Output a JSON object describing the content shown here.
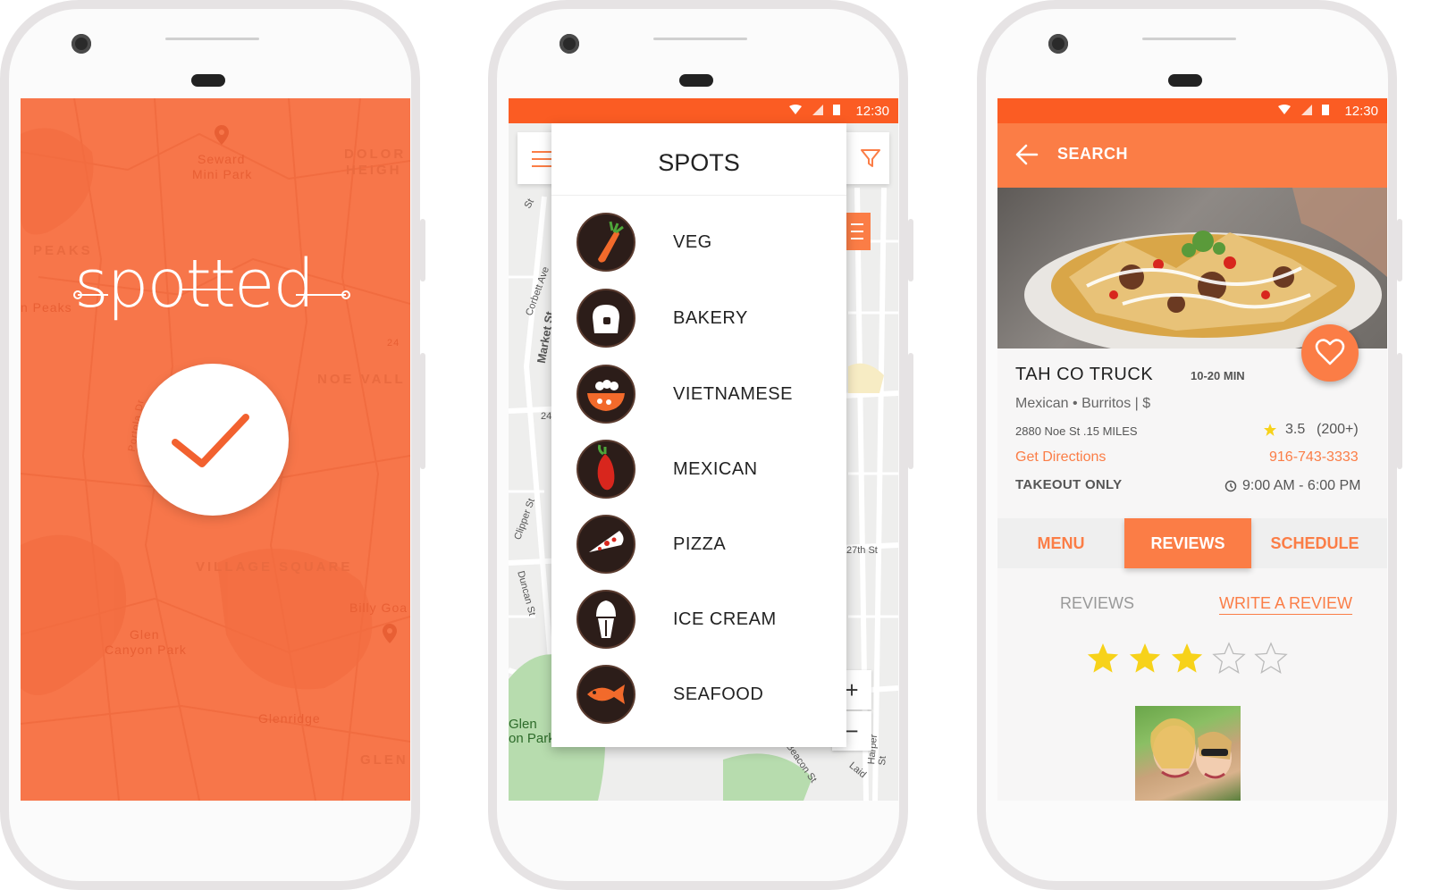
{
  "phone1": {
    "logo": "spotted",
    "map_labels": [
      "Seward",
      "Mini Park",
      "DOLOR",
      "HEIGH",
      "PEAKS",
      "n Peaks",
      "NOE VALL",
      "VILLAGE SQUARE",
      "Billy Goa",
      "Glen",
      "Canyon Park",
      "Glenridge",
      "GLEN",
      "Portola Dr",
      "24"
    ]
  },
  "status": {
    "time": "12:30"
  },
  "phone2": {
    "drawer_title": "SPOTS",
    "categories": [
      {
        "label": "VEG",
        "icon": "carrot-icon"
      },
      {
        "label": "BAKERY",
        "icon": "bread-icon"
      },
      {
        "label": "VIETNAMESE",
        "icon": "noodle-bowl-icon"
      },
      {
        "label": "MEXICAN",
        "icon": "chili-pepper-icon"
      },
      {
        "label": "PIZZA",
        "icon": "pizza-slice-icon"
      },
      {
        "label": "ICE CREAM",
        "icon": "ice-cream-icon"
      },
      {
        "label": "SEAFOOD",
        "icon": "fish-icon"
      }
    ],
    "streets": [
      "Corbett Ave",
      "Market St",
      "27th St",
      "Duncan St",
      "Clipper St",
      "24",
      "Glen",
      "on Park",
      "Laid",
      "Beacon St",
      "Harper St",
      "St"
    ],
    "zoom_in": "+",
    "zoom_out": "−"
  },
  "phone3": {
    "appbar_title": "SEARCH",
    "name": "TAH CO TRUCK",
    "eta": "10-20 MIN",
    "cuisine": "Mexican • Burritos  |  $",
    "address": "2880 Noe St .15 MILES",
    "rating": "3.5",
    "rating_count": "(200+)",
    "directions": "Get Directions",
    "phone": "916-743-3333",
    "takeout": "TAKEOUT ONLY",
    "hours": "9:00 AM - 6:00 PM",
    "tabs": [
      "MENU",
      "REVIEWS",
      "SCHEDULE"
    ],
    "active_tab": "REVIEWS",
    "reviews_label": "REVIEWS",
    "write_review": "WRITE A REVIEW",
    "stars_filled": 3,
    "stars_total": 5
  },
  "colors": {
    "accent": "#fb7d46",
    "status_bar": "#fb5c23",
    "splash": "#f7764a",
    "star": "#f7d21a",
    "icon_dark": "#2c1d19"
  }
}
